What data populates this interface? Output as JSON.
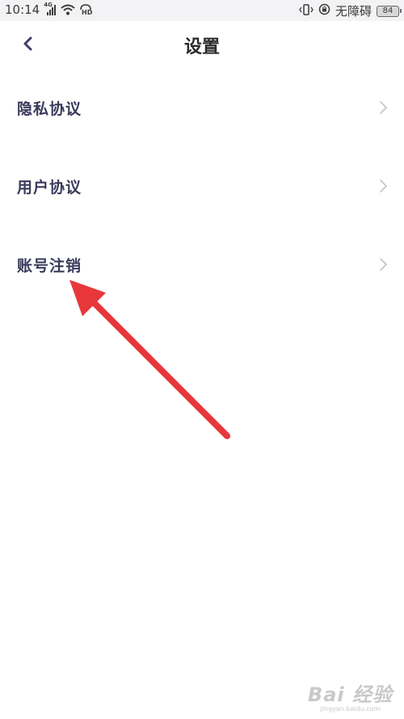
{
  "status_bar": {
    "time": "10:14",
    "network_tag": "4G",
    "right_label": "无障碍",
    "battery": "84"
  },
  "header": {
    "title": "设置",
    "back_icon": "chevron-left-icon"
  },
  "menu": {
    "items": [
      {
        "label": "隐私协议",
        "icon": "chevron-right-icon"
      },
      {
        "label": "用户协议",
        "icon": "chevron-right-icon"
      },
      {
        "label": "账号注销",
        "icon": "chevron-right-icon"
      }
    ]
  },
  "annotation": {
    "arrow_color": "#e8373b",
    "target": "账号注销"
  },
  "watermark": {
    "logo": "Bai 经验",
    "url": "jingyan.baidu.com"
  },
  "colors": {
    "menu_text": "#3a3a5c",
    "back_icon": "#3d3d66",
    "chevron": "#c4c4c4",
    "status_bar_bg": "#f3f3f5"
  }
}
